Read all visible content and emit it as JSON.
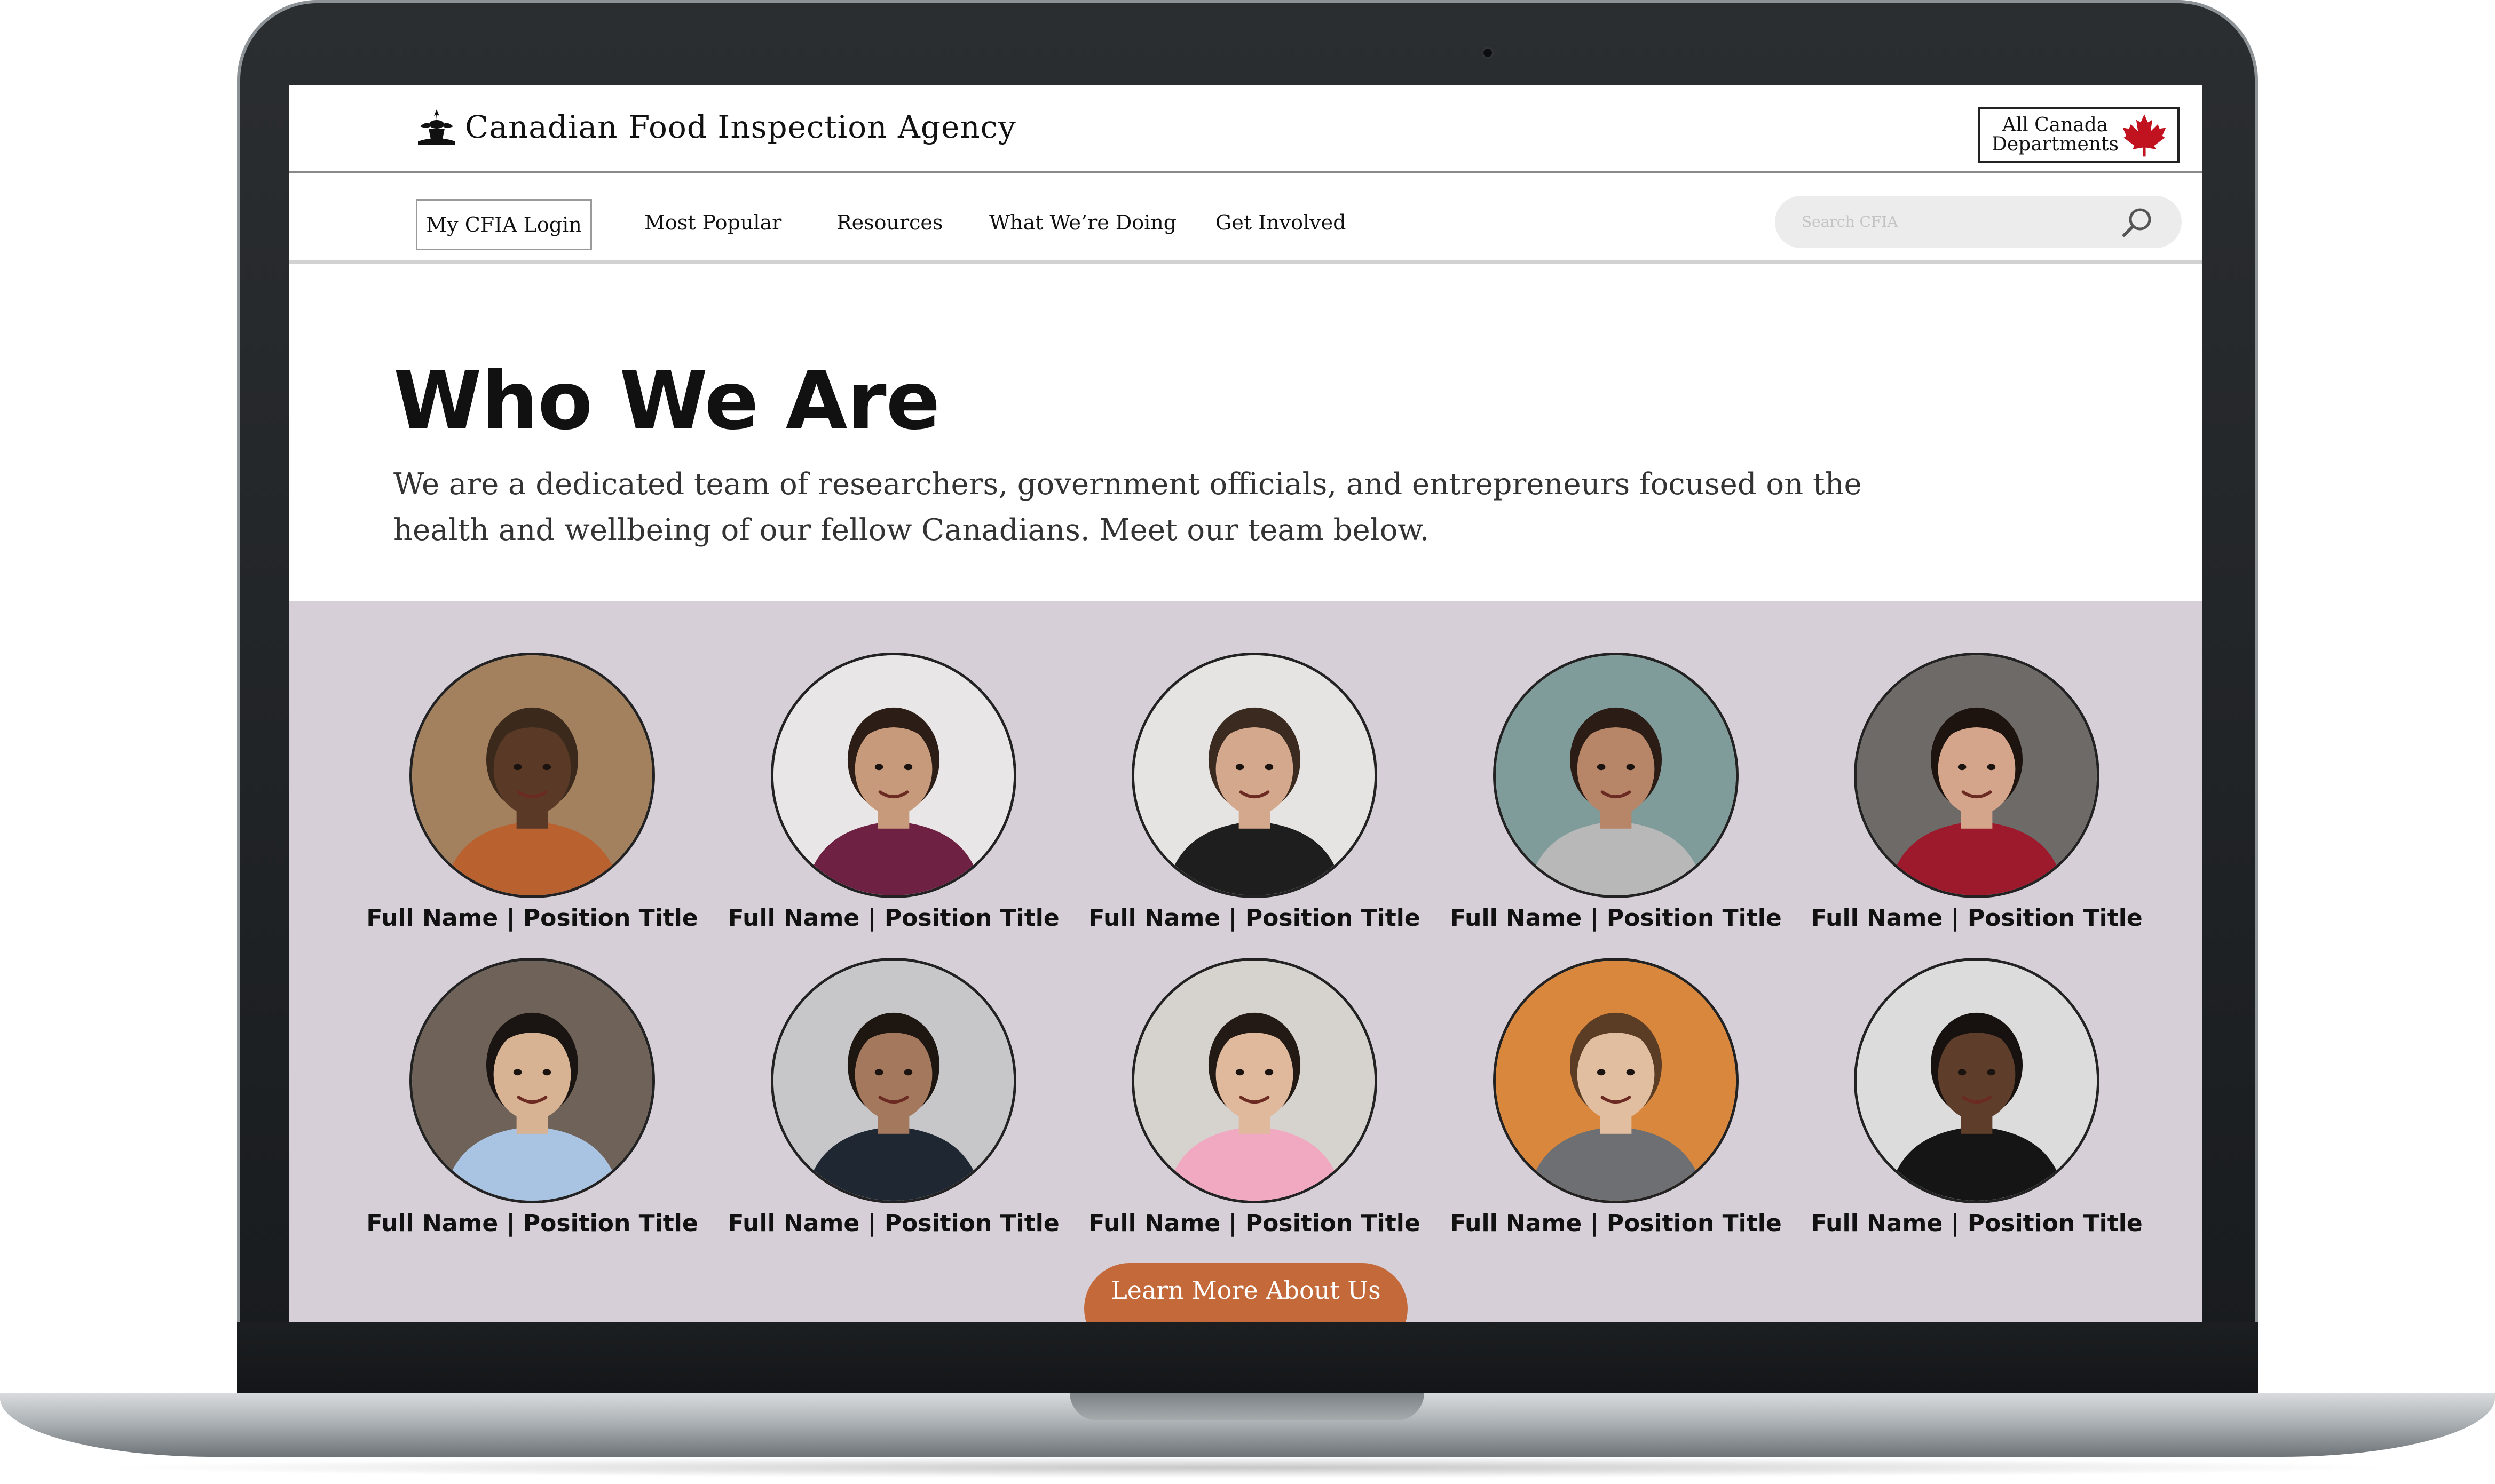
{
  "header": {
    "agency_name": "Canadian Food Inspection Agency",
    "all_canada_label": "All Canada\nDepartments"
  },
  "nav": {
    "login": "My CFIA Login",
    "items": [
      "Most Popular",
      "Resources",
      "What We’re Doing",
      "Get Involved"
    ],
    "search_placeholder": "Search CFIA"
  },
  "hero": {
    "title": "Who We Are",
    "description": "We are a dedicated team of researchers, government officials, and entrepreneurs focused on the health and wellbeing of our fellow Canadians. Meet our team below."
  },
  "team": {
    "members": [
      {
        "caption": "Full Name | Position Title",
        "bg": "#a3815f",
        "skin": "#5a3a26",
        "hair": "#3b2a1c",
        "shirt": "#b9622f"
      },
      {
        "caption": "Full Name | Position Title",
        "bg": "#e8e6e6",
        "skin": "#c89a7c",
        "hair": "#2c1d16",
        "shirt": "#6e2143"
      },
      {
        "caption": "Full Name | Position Title",
        "bg": "#e6e4e2",
        "skin": "#d4a88c",
        "hair": "#3a2a20",
        "shirt": "#1e1e1e"
      },
      {
        "caption": "Full Name | Position Title",
        "bg": "#7f9c9a",
        "skin": "#b78668",
        "hair": "#2b1d15",
        "shirt": "#b8b8b8"
      },
      {
        "caption": "Full Name | Position Title",
        "bg": "#6d6a68",
        "skin": "#d4a58a",
        "hair": "#1d1410",
        "shirt": "#9c1a2c"
      },
      {
        "caption": "Full Name | Position Title",
        "bg": "#6f6258",
        "skin": "#d8b393",
        "hair": "#1a1512",
        "shirt": "#a9c3e2"
      },
      {
        "caption": "Full Name | Position Title",
        "bg": "#c7c7c9",
        "skin": "#a4785c",
        "hair": "#1d1611",
        "shirt": "#1f2733"
      },
      {
        "caption": "Full Name | Position Title",
        "bg": "#d6d2cd",
        "skin": "#e0b99c",
        "hair": "#241a15",
        "shirt": "#f1a9c2"
      },
      {
        "caption": "Full Name | Position Title",
        "bg": "#d9873d",
        "skin": "#e2bea0",
        "hair": "#5b3d26",
        "shirt": "#6d6f73"
      },
      {
        "caption": "Full Name | Position Title",
        "bg": "#dcdcdc",
        "skin": "#5e3d2a",
        "hair": "#171210",
        "shirt": "#151515"
      }
    ],
    "cta_label": "Learn More About Us"
  }
}
